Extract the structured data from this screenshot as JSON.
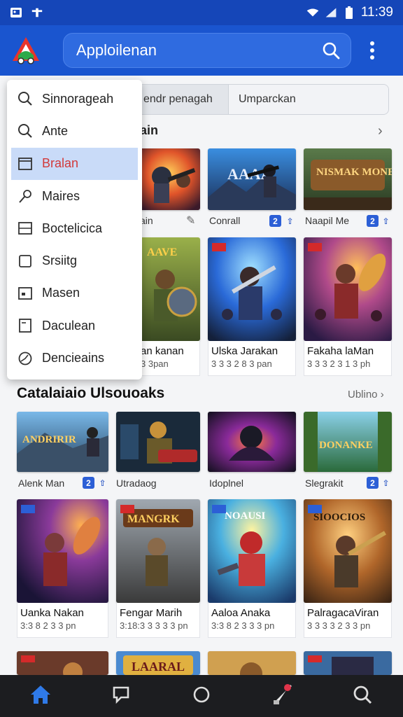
{
  "status_bar": {
    "time": "11:39"
  },
  "app_bar": {
    "title": "Apploilenan",
    "colors": {
      "bar": "#1a55cf",
      "status": "#1546b8"
    }
  },
  "filters": {
    "tab1": "endr penagah",
    "tab2": "Umparckan"
  },
  "section1": {
    "heading_fragment": "ain"
  },
  "menu": {
    "items": [
      {
        "label": "Sinnorageah",
        "icon": "search-icon"
      },
      {
        "label": "Ante",
        "icon": "search-icon"
      },
      {
        "label": "Bralan",
        "icon": "window-icon",
        "selected": true
      },
      {
        "label": "Maires",
        "icon": "pin-icon"
      },
      {
        "label": "Boctelicica",
        "icon": "window-icon"
      },
      {
        "label": "Srsiitg",
        "icon": "square-icon"
      },
      {
        "label": "Masen",
        "icon": "image-icon"
      },
      {
        "label": "Daculean",
        "icon": "document-icon"
      },
      {
        "label": "Dencieains",
        "icon": "clock-icon"
      }
    ]
  },
  "row1": [
    {
      "caption": "ain"
    },
    {
      "caption": "Conrall"
    },
    {
      "caption": "Naapil Me"
    }
  ],
  "row2": [
    {
      "name": "an kanan",
      "sub": "3 3pan"
    },
    {
      "name": "Ulska Jarakan",
      "sub": "3 3 3 2 8 3 pan"
    },
    {
      "name": "Fakaha laMan",
      "sub": "3 3 3 2 3 1 3 ph"
    }
  ],
  "section2": {
    "title": "Catalaiaio Ulsouoaks",
    "more": "Ublino",
    "row1": [
      {
        "caption": "Alenk Man"
      },
      {
        "caption": "Utradaog"
      },
      {
        "caption": "Idoplnel"
      },
      {
        "caption": "Slegrakit"
      }
    ],
    "row2": [
      {
        "name": "Uanka Nakan",
        "sub": "3:3 8 2 3 3 pn"
      },
      {
        "name": "Fengar Marih",
        "sub": "3:18:3 3 3 3 3 pn"
      },
      {
        "name": "Aaloa Anaka",
        "sub": "3:3 8 2 3 3 3 pn"
      },
      {
        "name": "PalragacaViran",
        "sub": "3 3 3 3 2 3 3 pn"
      }
    ]
  },
  "tile_labels": {
    "r1c2": "AAAA",
    "r1c3": "NISMAK MONES",
    "r2c2": "AAVE",
    "r3c1": "ANDRIRIR",
    "r3c4": "DONANKE",
    "r4c2": "MANGRK",
    "r4c3": "NOAUSI",
    "r4c4": "SIOOCIOS",
    "r5c2": "LAARAL"
  },
  "bottom_nav": {
    "items": [
      {
        "icon": "home-icon"
      },
      {
        "icon": "chat-icon"
      },
      {
        "icon": "circle-icon"
      },
      {
        "icon": "rocket-icon"
      },
      {
        "icon": "search-icon"
      }
    ]
  }
}
